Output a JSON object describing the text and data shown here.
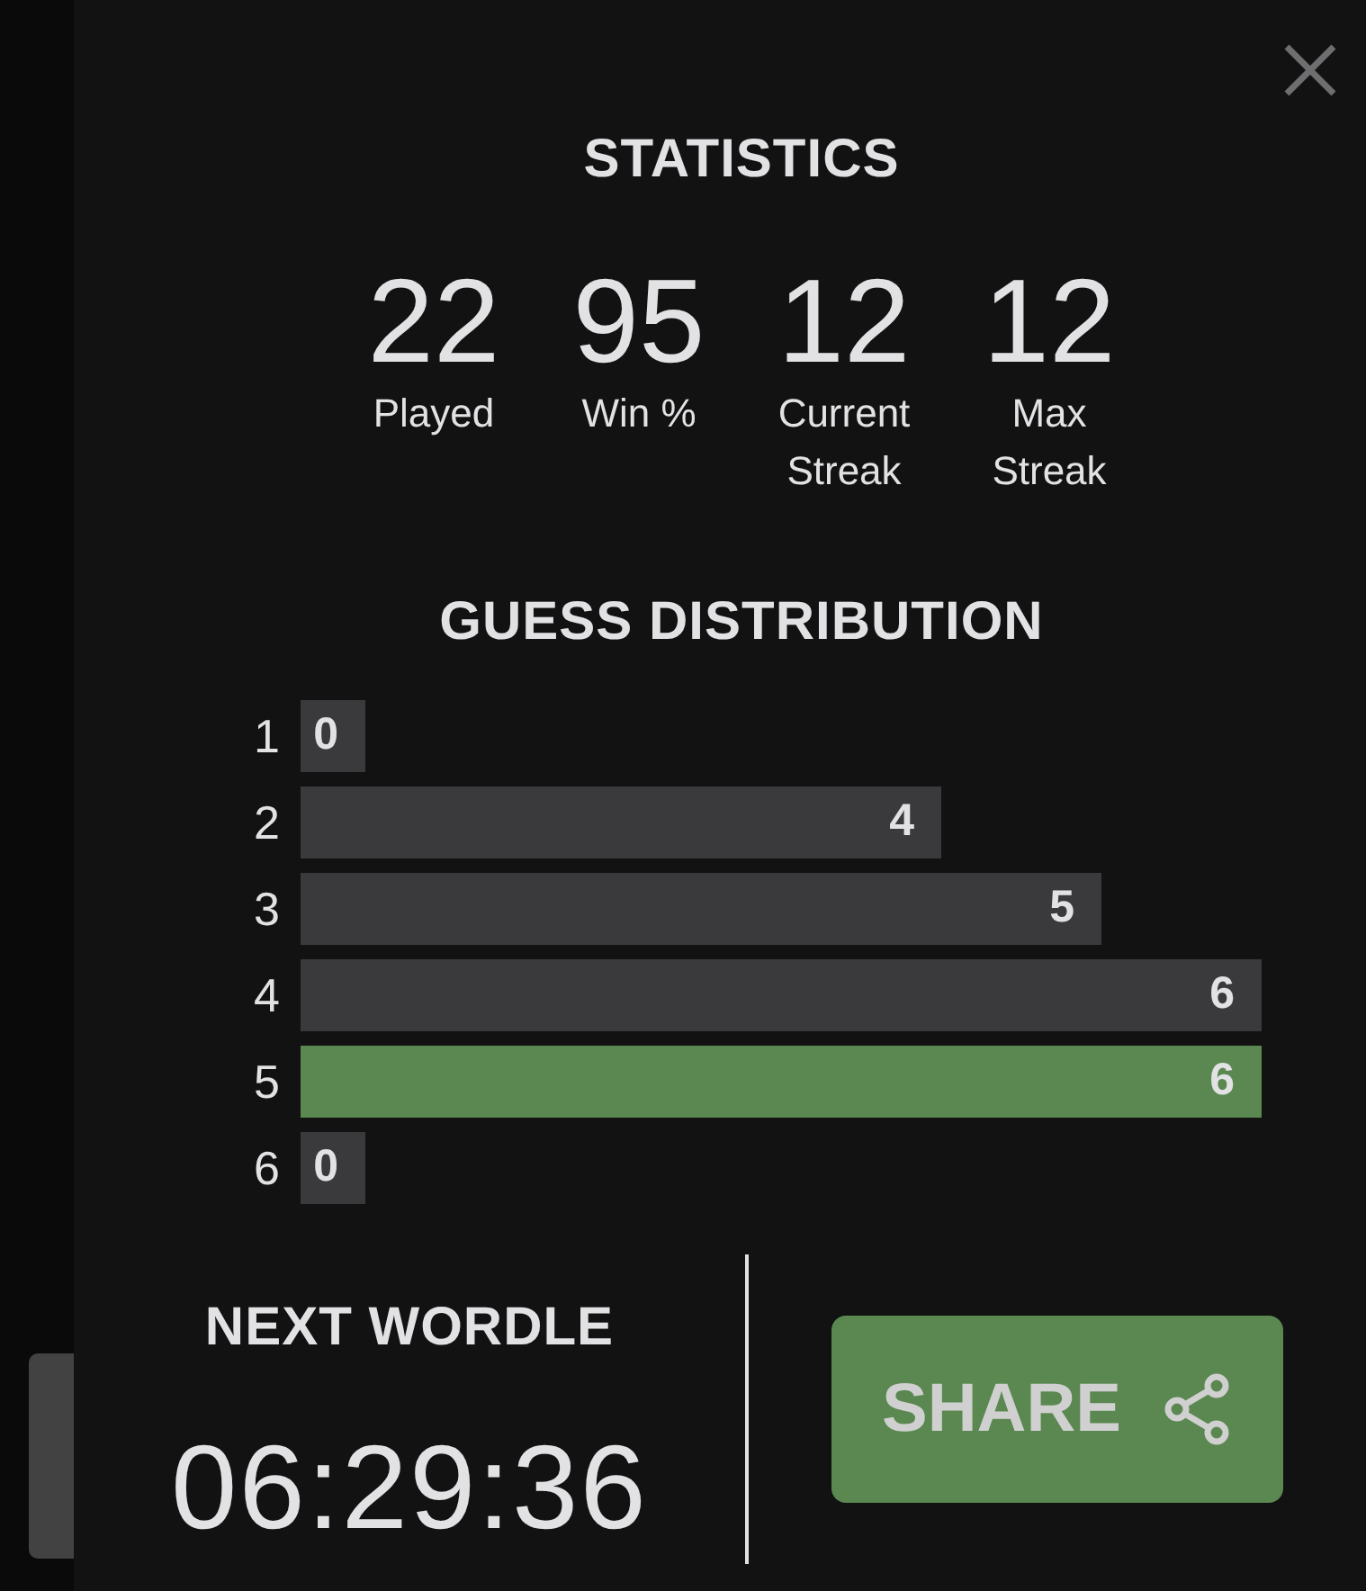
{
  "title": "STATISTICS",
  "stats": [
    {
      "value": "22",
      "label": "Played"
    },
    {
      "value": "95",
      "label": "Win %"
    },
    {
      "value": "12",
      "label": "Current Streak"
    },
    {
      "value": "12",
      "label": "Max Streak"
    }
  ],
  "guess_distribution": {
    "title": "GUESS DISTRIBUTION",
    "rows": [
      {
        "guess": "1",
        "count": "0",
        "selected": false
      },
      {
        "guess": "2",
        "count": "4",
        "selected": false
      },
      {
        "guess": "3",
        "count": "5",
        "selected": false
      },
      {
        "guess": "4",
        "count": "6",
        "selected": false
      },
      {
        "guess": "5",
        "count": "6",
        "selected": true
      },
      {
        "guess": "6",
        "count": "0",
        "selected": false
      }
    ]
  },
  "next_wordle": {
    "label": "NEXT WORDLE",
    "countdown": "06:29:36"
  },
  "share_button": {
    "label": "SHARE"
  }
}
